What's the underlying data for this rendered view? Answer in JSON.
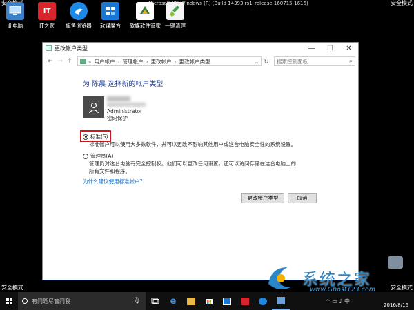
{
  "desktop": {
    "safe_mode_label": "安全模式",
    "os_title": "Microsoft (R) Windows (R) (Build 14393.rs1_release.160715-1616)",
    "icons": [
      {
        "label": "此电脑",
        "color": "#3c80c8"
      },
      {
        "label": "IT之家",
        "color": "#d6262c",
        "glyph": "IT"
      },
      {
        "label": "旗鱼浏览器",
        "color": "#1e88e5"
      },
      {
        "label": "软媒魔方",
        "color": "#1976d2"
      },
      {
        "label": "软媒软件管家",
        "color": "#2e7d32"
      },
      {
        "label": "一键清理",
        "color": "#43a047"
      }
    ]
  },
  "window": {
    "title": "更改帐户类型",
    "breadcrumb": [
      "用户帐户",
      "管理帐户",
      "更改帐户",
      "更改帐户类型"
    ],
    "search_placeholder": "搜索控制面板",
    "heading": "为 陈晨 选择新的帐户类型",
    "account": {
      "role": "Administrator",
      "password_status": "密码保护"
    },
    "options": [
      {
        "label": "标准(S)",
        "selected": true,
        "description": "标准帐户可以使用大多数软件，并可以更改不影响其他用户或这台电脑安全性的系统设置。"
      },
      {
        "label": "管理员(A)",
        "selected": false,
        "description": "管理员对这台电脑有完全控制权。他们可以更改任何设置，还可以访问存储在这台电脑上的所有文件和程序。"
      }
    ],
    "help_link": "为什么建议使用标准帐户?",
    "buttons": {
      "change": "更改帐户类型",
      "cancel": "取消"
    }
  },
  "taskbar": {
    "search_placeholder": "有问题尽管问我",
    "date": "2016/8/16"
  },
  "watermark": {
    "title": "系统之家",
    "url": "www.Ghost123.com"
  },
  "colors": {
    "accent": "#1e3a8a",
    "highlight": "#d0161c",
    "link": "#1a6fc6"
  }
}
